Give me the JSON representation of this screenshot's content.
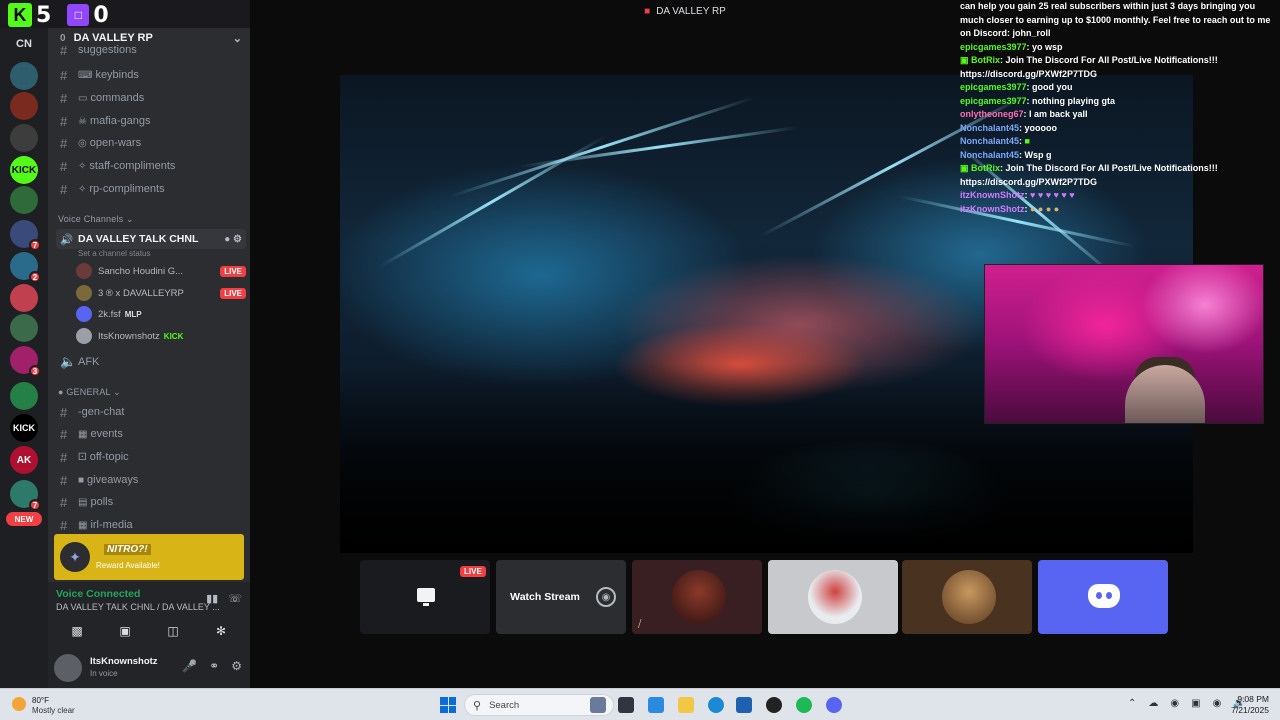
{
  "overlay": {
    "kick_count": "5",
    "twitch_count": "0",
    "kick_letter": "K"
  },
  "window": {
    "title": "DA VALLEY RP"
  },
  "rail": {
    "top_label": "CN",
    "new_label": "NEW"
  },
  "server": {
    "name": "DA VALLEY RP",
    "boost": "0"
  },
  "channels": [
    {
      "name": "suggestions"
    },
    {
      "name": "keybinds"
    },
    {
      "name": "commands"
    },
    {
      "name": "mafia-gangs"
    },
    {
      "name": "open-wars"
    },
    {
      "name": "staff-compliments"
    },
    {
      "name": "rp-compliments"
    }
  ],
  "voice": {
    "category": "Voice Channels",
    "channel": "DA VALLEY TALK CHNL",
    "status_prompt": "Set a channel status",
    "members": [
      {
        "name": "Sancho Houdini G...",
        "tag": "LIVE"
      },
      {
        "name": "3 ® x DAVALLEYRP",
        "tag": "LIVE"
      },
      {
        "name": "2k.fsf",
        "tag": "MLP"
      },
      {
        "name": "ItsKnownshotz",
        "tag": "KICK"
      }
    ],
    "afk": "AFK"
  },
  "general": {
    "category": "GENERAL",
    "channels": [
      {
        "name": "-gen-chat"
      },
      {
        "name": "events"
      },
      {
        "name": "off-topic"
      },
      {
        "name": "giveaways"
      },
      {
        "name": "polls"
      },
      {
        "name": "irl-media"
      }
    ]
  },
  "reward": {
    "title": "NITRO?!",
    "subtitle": "Reward Available!"
  },
  "voice_panel": {
    "title": "Voice Connected",
    "subtitle": "DA VALLEY TALK CHNL / DA VALLEY ..."
  },
  "user": {
    "name": "ItsKnownshotz",
    "status": "In voice"
  },
  "chat": [
    {
      "user": "",
      "text": "can help you gain 25 real subscribers within just 3 days bringing you much closer to earning up to $1000 monthly. Feel free to reach out to me on Discord: john_roll"
    },
    {
      "user": "epicgames3977",
      "text": ": yo wsp"
    },
    {
      "user": "BotRix",
      "text": ": Join The Discord For All Post/Live Notifications!!! https://discord.gg/PXWf2P7TDG"
    },
    {
      "user": "epicgames3977",
      "text": ": good you"
    },
    {
      "user": "epicgames3977",
      "text": ": nothing playing gta"
    },
    {
      "user": "onlytheoneg67",
      "text": ": I am back yall"
    },
    {
      "user": "Nonchalant45",
      "text": ": yooooo"
    },
    {
      "user": "Nonchalant45",
      "text": ":"
    },
    {
      "user": "Nonchalant45",
      "text": ": Wsp g"
    },
    {
      "user": "BotRix",
      "text": ": Join The Discord For All Post/Live Notifications!!! https://discord.gg/PXWf2P7TDG"
    },
    {
      "user": "itzKnownShotz",
      "text": ":"
    },
    {
      "user": "itzKnownShotz",
      "text": ":"
    }
  ],
  "tiles": {
    "live": "LIVE",
    "watch": "Watch Stream"
  },
  "taskbar": {
    "temp": "80°F",
    "condition": "Mostly clear",
    "search": "Search",
    "time": "9:08 PM",
    "date": "7/21/2025"
  }
}
